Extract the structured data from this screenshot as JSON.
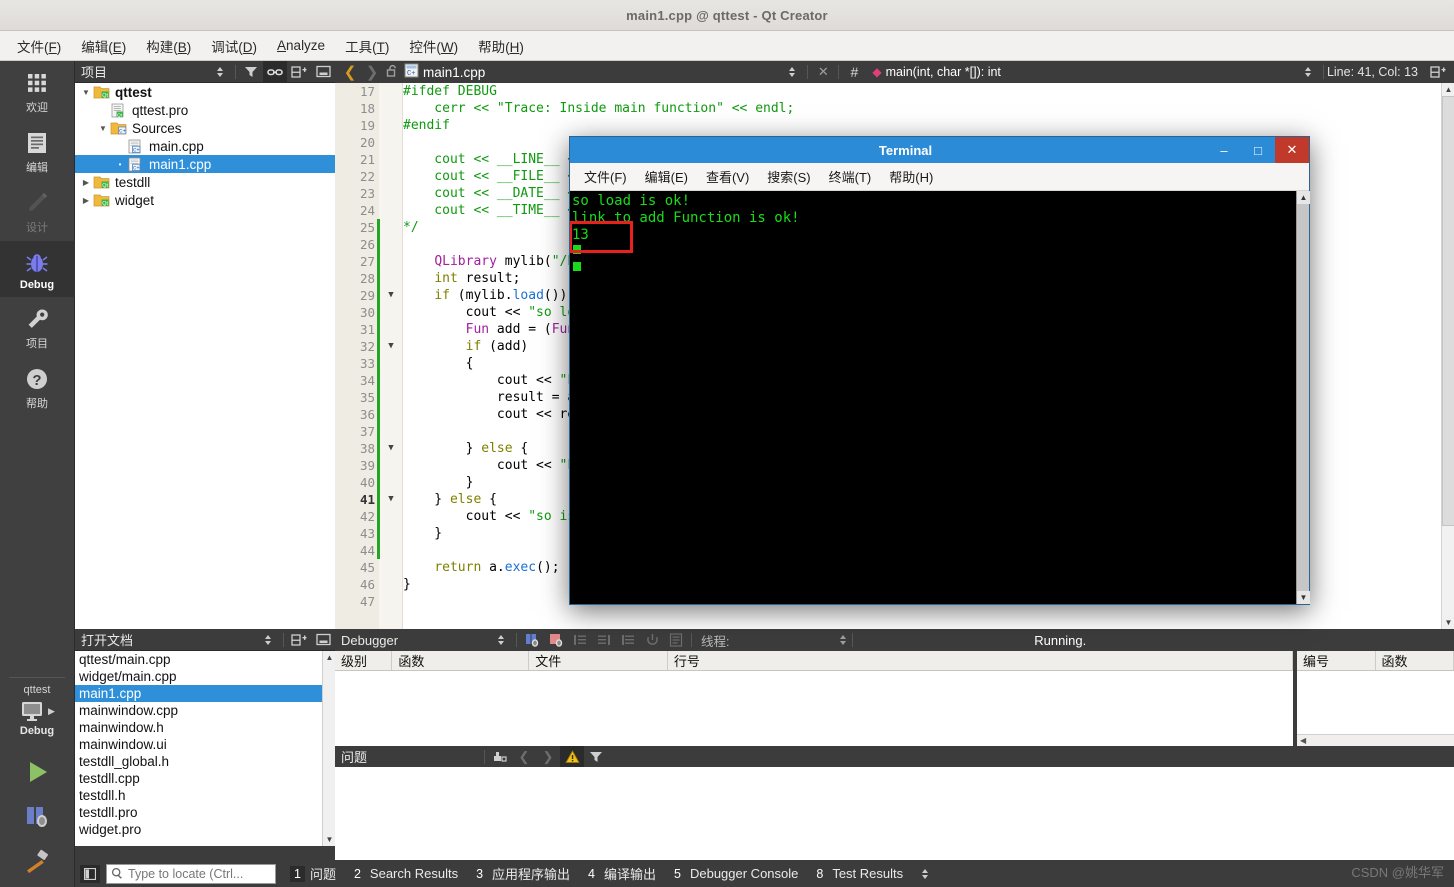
{
  "window": {
    "title": "main1.cpp @ qttest - Qt Creator"
  },
  "menubar": [
    {
      "label": "文件(F)",
      "mnemonic": "F"
    },
    {
      "label": "编辑(E)",
      "mnemonic": "E"
    },
    {
      "label": "构建(B)",
      "mnemonic": "B"
    },
    {
      "label": "调试(D)",
      "mnemonic": "D"
    },
    {
      "label": "Analyze",
      "mnemonic": "A"
    },
    {
      "label": "工具(T)",
      "mnemonic": "T"
    },
    {
      "label": "控件(W)",
      "mnemonic": "W"
    },
    {
      "label": "帮助(H)",
      "mnemonic": "H"
    }
  ],
  "modebar": {
    "modes": [
      {
        "label": "欢迎",
        "icon": "grid-icon",
        "state": "normal"
      },
      {
        "label": "编辑",
        "icon": "document-icon",
        "state": "normal"
      },
      {
        "label": "设计",
        "icon": "pencil-icon",
        "state": "disabled"
      },
      {
        "label": "Debug",
        "icon": "bug-icon",
        "state": "active"
      },
      {
        "label": "项目",
        "icon": "wrench-icon",
        "state": "normal"
      },
      {
        "label": "帮助",
        "icon": "question-icon",
        "state": "normal"
      }
    ],
    "kit": {
      "project": "qttest",
      "config": "Debug",
      "icon": "desktop-icon"
    },
    "actions": [
      {
        "name": "run-button",
        "icon": "play-icon"
      },
      {
        "name": "debug-button",
        "icon": "debug-icon"
      },
      {
        "name": "build-button",
        "icon": "hammer-icon"
      }
    ]
  },
  "projects_panel": {
    "title": "项目",
    "tools": [
      {
        "name": "filter-icon",
        "active": false
      },
      {
        "name": "link-icon",
        "active": true
      },
      {
        "name": "split-icon",
        "active": false
      },
      {
        "name": "close-panel-icon",
        "active": false
      }
    ],
    "tree": [
      {
        "depth": 0,
        "label": "qttest",
        "icon": "qt-project-icon",
        "arrow": "open",
        "bold": true,
        "selected": false
      },
      {
        "depth": 1,
        "label": "qttest.pro",
        "icon": "pro-file-icon",
        "arrow": "none",
        "bold": false,
        "selected": false
      },
      {
        "depth": 1,
        "label": "Sources",
        "icon": "cpp-folder-icon",
        "arrow": "open",
        "bold": false,
        "selected": false
      },
      {
        "depth": 2,
        "label": "main.cpp",
        "icon": "cpp-file-icon",
        "arrow": "none",
        "bold": false,
        "selected": false
      },
      {
        "depth": 2,
        "label": "main1.cpp",
        "icon": "cpp-file-icon",
        "arrow": "none",
        "bold": false,
        "selected": true
      },
      {
        "depth": 0,
        "label": "testdll",
        "icon": "qt-project-icon",
        "arrow": "closed",
        "bold": false,
        "selected": false
      },
      {
        "depth": 0,
        "label": "widget",
        "icon": "qt-project-icon",
        "arrow": "closed",
        "bold": false,
        "selected": false
      }
    ]
  },
  "opendocs_panel": {
    "title": "打开文档",
    "tools": [
      {
        "name": "split-icon"
      },
      {
        "name": "close-panel-icon"
      }
    ],
    "documents": [
      {
        "label": "qttest/main.cpp",
        "selected": false
      },
      {
        "label": "widget/main.cpp",
        "selected": false
      },
      {
        "label": "main1.cpp",
        "selected": true
      },
      {
        "label": "mainwindow.cpp",
        "selected": false
      },
      {
        "label": "mainwindow.h",
        "selected": false
      },
      {
        "label": "mainwindow.ui",
        "selected": false
      },
      {
        "label": "testdll_global.h",
        "selected": false
      },
      {
        "label": "testdll.cpp",
        "selected": false
      },
      {
        "label": "testdll.h",
        "selected": false
      },
      {
        "label": "testdll.pro",
        "selected": false
      },
      {
        "label": "widget.pro",
        "selected": false
      }
    ]
  },
  "editor": {
    "filename": "main1.cpp",
    "symbol": "main(int, char *[]): int",
    "line_col": "Line: 41, Col: 13",
    "first_line": 17,
    "current_line": 41,
    "lines": [
      {
        "n": 17,
        "fold": "",
        "green": false,
        "tokens": [
          {
            "t": "#ifdef DEBUG",
            "c": "cmt"
          }
        ]
      },
      {
        "n": 18,
        "fold": "",
        "green": false,
        "tokens": [
          {
            "t": "    cerr << \"Trace: Inside main function\" << endl;",
            "c": "cmt"
          }
        ]
      },
      {
        "n": 19,
        "fold": "",
        "green": false,
        "tokens": [
          {
            "t": "#endif",
            "c": "cmt"
          }
        ]
      },
      {
        "n": 20,
        "fold": "",
        "green": false,
        "tokens": [
          {
            "t": "",
            "c": "cmt"
          }
        ]
      },
      {
        "n": 21,
        "fold": "",
        "green": false,
        "tokens": [
          {
            "t": "    cout << __LINE__ <<",
            "c": "cmt"
          }
        ]
      },
      {
        "n": 22,
        "fold": "",
        "green": false,
        "tokens": [
          {
            "t": "    cout << __FILE__ <<",
            "c": "cmt"
          }
        ]
      },
      {
        "n": 23,
        "fold": "",
        "green": false,
        "tokens": [
          {
            "t": "    cout << __DATE__ <<",
            "c": "cmt"
          }
        ]
      },
      {
        "n": 24,
        "fold": "",
        "green": false,
        "tokens": [
          {
            "t": "    cout << __TIME__ <<",
            "c": "cmt"
          }
        ]
      },
      {
        "n": 25,
        "fold": "",
        "green": true,
        "tokens": [
          {
            "t": "*/",
            "c": "cmt"
          }
        ]
      },
      {
        "n": 26,
        "fold": "",
        "green": true,
        "tokens": [
          {
            "t": "",
            "c": "pl"
          }
        ]
      },
      {
        "n": 27,
        "fold": "",
        "green": true,
        "tokens": [
          {
            "t": "    ",
            "c": "pl"
          },
          {
            "t": "QLibrary",
            "c": "typ"
          },
          {
            "t": " mylib(",
            "c": "pl"
          },
          {
            "t": "\"/ho",
            "c": "str"
          }
        ]
      },
      {
        "n": 28,
        "fold": "",
        "green": true,
        "tokens": [
          {
            "t": "    ",
            "c": "pl"
          },
          {
            "t": "int",
            "c": "kw"
          },
          {
            "t": " result;",
            "c": "pl"
          }
        ]
      },
      {
        "n": 29,
        "fold": "▼",
        "green": true,
        "tokens": [
          {
            "t": "    ",
            "c": "pl"
          },
          {
            "t": "if",
            "c": "kw"
          },
          {
            "t": " (mylib.",
            "c": "pl"
          },
          {
            "t": "load",
            "c": "fn"
          },
          {
            "t": "()) {",
            "c": "pl"
          }
        ]
      },
      {
        "n": 30,
        "fold": "",
        "green": true,
        "tokens": [
          {
            "t": "        cout << ",
            "c": "pl"
          },
          {
            "t": "\"so loa",
            "c": "str"
          }
        ]
      },
      {
        "n": 31,
        "fold": "",
        "green": true,
        "tokens": [
          {
            "t": "        ",
            "c": "pl"
          },
          {
            "t": "Fun",
            "c": "typ"
          },
          {
            "t": " add = (",
            "c": "pl"
          },
          {
            "t": "Fun",
            "c": "typ"
          },
          {
            "t": ")",
            "c": "pl"
          }
        ]
      },
      {
        "n": 32,
        "fold": "▼",
        "green": true,
        "tokens": [
          {
            "t": "        ",
            "c": "pl"
          },
          {
            "t": "if",
            "c": "kw"
          },
          {
            "t": " (add)",
            "c": "pl"
          }
        ]
      },
      {
        "n": 33,
        "fold": "",
        "green": true,
        "tokens": [
          {
            "t": "        {",
            "c": "pl"
          }
        ]
      },
      {
        "n": 34,
        "fold": "",
        "green": true,
        "tokens": [
          {
            "t": "            cout << ",
            "c": "pl"
          },
          {
            "t": "\"Li",
            "c": "str"
          }
        ]
      },
      {
        "n": 35,
        "fold": "",
        "green": true,
        "tokens": [
          {
            "t": "            result = ad",
            "c": "pl"
          }
        ]
      },
      {
        "n": 36,
        "fold": "",
        "green": true,
        "tokens": [
          {
            "t": "            cout << res",
            "c": "pl"
          }
        ]
      },
      {
        "n": 37,
        "fold": "",
        "green": true,
        "tokens": [
          {
            "t": "",
            "c": "pl"
          }
        ]
      },
      {
        "n": 38,
        "fold": "▼",
        "green": true,
        "tokens": [
          {
            "t": "        } ",
            "c": "pl"
          },
          {
            "t": "else",
            "c": "kw"
          },
          {
            "t": " {",
            "c": "pl"
          }
        ]
      },
      {
        "n": 39,
        "fold": "",
        "green": true,
        "tokens": [
          {
            "t": "            cout << ",
            "c": "pl"
          },
          {
            "t": "\"Li",
            "c": "str"
          }
        ]
      },
      {
        "n": 40,
        "fold": "",
        "green": true,
        "tokens": [
          {
            "t": "        }",
            "c": "pl"
          }
        ]
      },
      {
        "n": 41,
        "fold": "▼",
        "green": true,
        "tokens": [
          {
            "t": "    } ",
            "c": "pl"
          },
          {
            "t": "else",
            "c": "kw"
          },
          {
            "t": " {",
            "c": "pl"
          }
        ]
      },
      {
        "n": 42,
        "fold": "",
        "green": true,
        "tokens": [
          {
            "t": "        cout << ",
            "c": "pl"
          },
          {
            "t": "\"so is",
            "c": "str"
          }
        ]
      },
      {
        "n": 43,
        "fold": "",
        "green": true,
        "tokens": [
          {
            "t": "    }",
            "c": "pl"
          }
        ]
      },
      {
        "n": 44,
        "fold": "",
        "green": true,
        "tokens": [
          {
            "t": "",
            "c": "pl"
          }
        ]
      },
      {
        "n": 45,
        "fold": "",
        "green": false,
        "tokens": [
          {
            "t": "    ",
            "c": "pl"
          },
          {
            "t": "return",
            "c": "kw"
          },
          {
            "t": " a.",
            "c": "pl"
          },
          {
            "t": "exec",
            "c": "fn"
          },
          {
            "t": "();",
            "c": "pl"
          }
        ]
      },
      {
        "n": 46,
        "fold": "",
        "green": false,
        "tokens": [
          {
            "t": "}",
            "c": "pl"
          }
        ]
      },
      {
        "n": 47,
        "fold": "",
        "green": false,
        "tokens": [
          {
            "t": "",
            "c": "pl"
          }
        ]
      }
    ]
  },
  "terminal": {
    "title": "Terminal",
    "buttons": {
      "minimize": "–",
      "maximize": "□",
      "close": "✕"
    },
    "menu": [
      "文件(F)",
      "编辑(E)",
      "查看(V)",
      "搜索(S)",
      "终端(T)",
      "帮助(H)"
    ],
    "output": "so load is ok!\nlink to add Function is ok!\n13",
    "highlighted_value": "13"
  },
  "debugger_panel": {
    "title": "Debugger",
    "thread_label": "线程:",
    "status": "Running.",
    "columns_left": [
      "级别",
      "函数",
      "文件",
      "行号"
    ],
    "columns_right": [
      "编号",
      "函数"
    ],
    "rows": []
  },
  "issues_panel": {
    "title": "问题",
    "rows": []
  },
  "statusbar": {
    "locate_placeholder": "Type to locate (Ctrl...",
    "items": [
      {
        "num": "1",
        "label": "问题",
        "active": true
      },
      {
        "num": "2",
        "label": "Search Results",
        "active": false
      },
      {
        "num": "3",
        "label": "应用程序输出",
        "active": false
      },
      {
        "num": "4",
        "label": "编译输出",
        "active": false
      },
      {
        "num": "5",
        "label": "Debugger Console",
        "active": false
      },
      {
        "num": "8",
        "label": "Test Results",
        "active": false
      }
    ],
    "watermark": "CSDN @姚华军"
  },
  "colors": {
    "accent_blue": "#2f8fd8",
    "terminal_bar": "#2b8bd6",
    "terminal_close": "#c0392b",
    "terminal_green": "#19dc19",
    "highlight_red": "#e82020",
    "chrome_dark": "#3c3c3c",
    "modebar": "#404040"
  }
}
